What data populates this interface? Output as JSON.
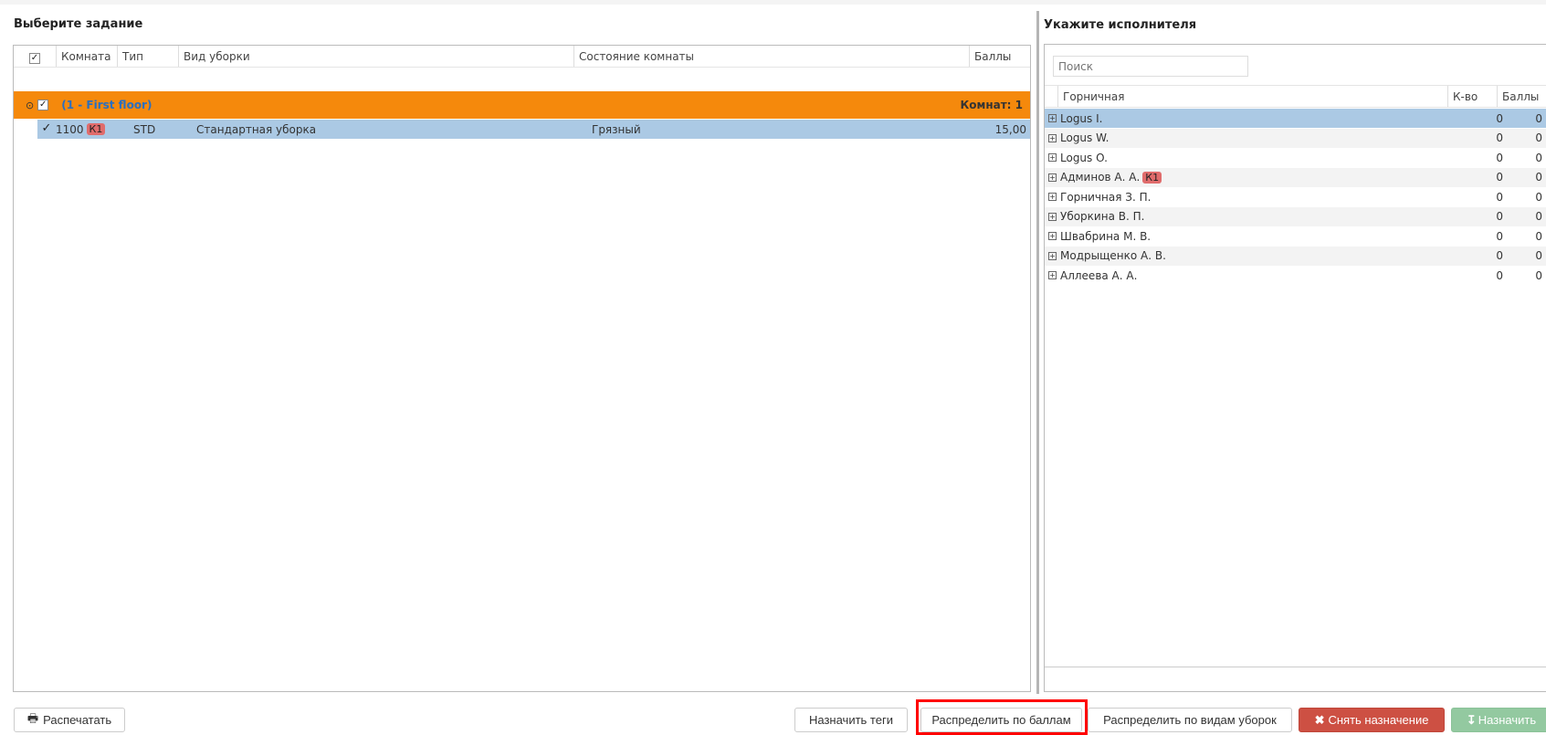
{
  "left": {
    "title": "Выберите задание",
    "columns": [
      "Комната",
      "Тип",
      "Вид уборки",
      "Состояние комнаты",
      "Баллы"
    ],
    "group": {
      "label": "(1 - First floor)",
      "count": "Комнат: 1",
      "color": "#f5890c"
    },
    "rows": [
      {
        "room": "1100",
        "badge": "К1",
        "type": "STD",
        "cleaning": "Стандартная уборка",
        "state": "Грязный",
        "points": "15,00"
      }
    ]
  },
  "right": {
    "title": "Укажите исполнителя",
    "search_placeholder": "Поиск",
    "columns": [
      "Горничная",
      "К-во",
      "Баллы"
    ],
    "rows": [
      {
        "name": "Logus I.",
        "count": "0",
        "points": "0",
        "selected": true
      },
      {
        "name": "Logus W.",
        "count": "0",
        "points": "0"
      },
      {
        "name": "Logus O.",
        "count": "0",
        "points": "0"
      },
      {
        "name": "Админов А. А.",
        "badge": "К1",
        "count": "0",
        "points": "0"
      },
      {
        "name": "Горничная З. П.",
        "count": "0",
        "points": "0"
      },
      {
        "name": "Уборкина В. П.",
        "count": "0",
        "points": "0"
      },
      {
        "name": "Швабрина М. В.",
        "count": "0",
        "points": "0"
      },
      {
        "name": "Модрыщенко А. В.",
        "count": "0",
        "points": "0"
      },
      {
        "name": "Аллеева А. А.",
        "count": "0",
        "points": "0"
      }
    ]
  },
  "buttons": {
    "print": "Распечатать",
    "tags": "Назначить теги",
    "by_points": "Распределить по баллам",
    "by_types": "Распределить по видам уборок",
    "unassign": "Снять назначение",
    "assign": "Назначить"
  },
  "colors": {
    "selected_row": "#abc9e4",
    "unassign": "#cd5043",
    "assign": "#93c9a0",
    "highlight": "#ff0000"
  }
}
